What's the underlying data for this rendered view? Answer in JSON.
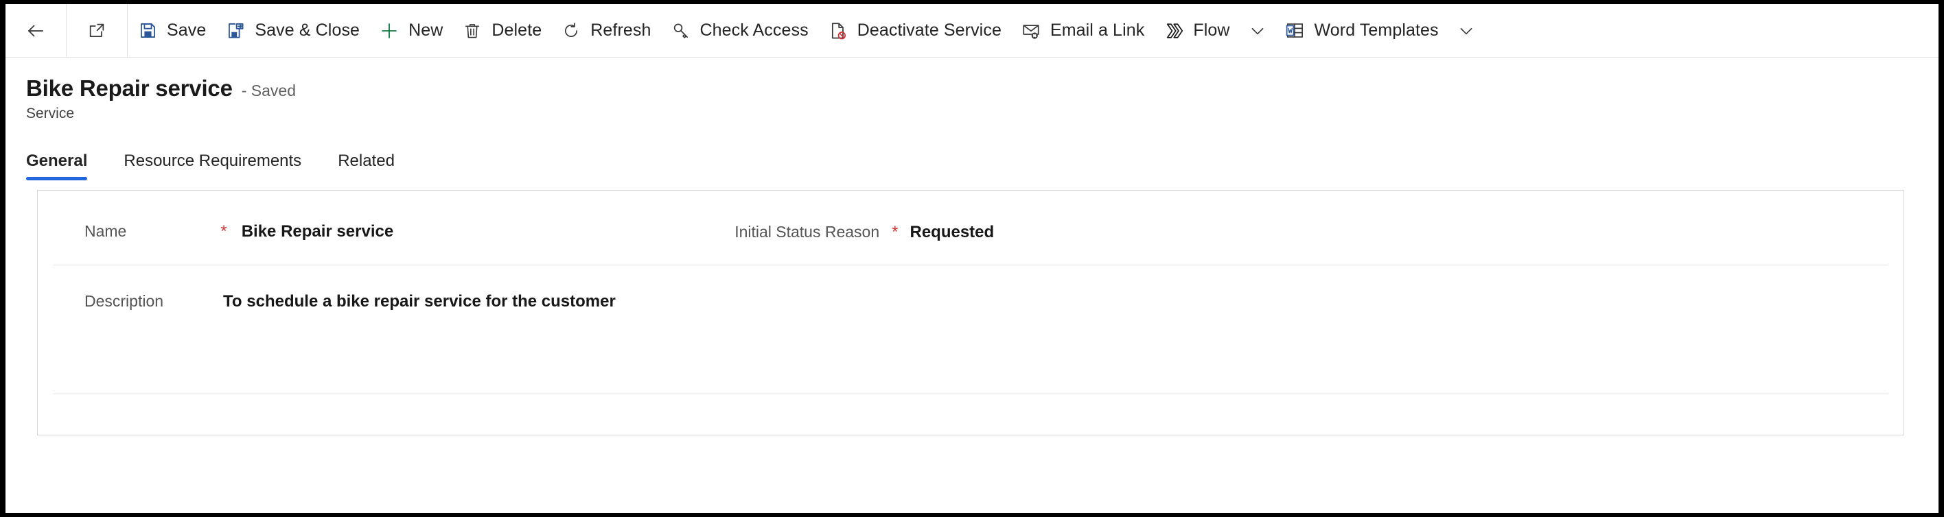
{
  "theme": {
    "accent": "#2266dd",
    "required_color": "#d13438",
    "border_color": "#d6d6d6",
    "label_color": "#545454"
  },
  "commandbar": {
    "back": {
      "icon": "back-arrow-icon",
      "label": "Back"
    },
    "popout": {
      "icon": "open-in-new-window-icon",
      "label": "Open in new window"
    },
    "buttons": [
      {
        "id": "save",
        "icon": "save-icon",
        "label": "Save"
      },
      {
        "id": "save-close",
        "icon": "save-and-close-icon",
        "label": "Save & Close"
      },
      {
        "id": "new",
        "icon": "plus-icon",
        "label": "New"
      },
      {
        "id": "delete",
        "icon": "trash-icon",
        "label": "Delete"
      },
      {
        "id": "refresh",
        "icon": "refresh-icon",
        "label": "Refresh"
      },
      {
        "id": "check-access",
        "icon": "key-icon",
        "label": "Check Access"
      },
      {
        "id": "deactivate",
        "icon": "deactivate-icon",
        "label": "Deactivate Service"
      },
      {
        "id": "email-link",
        "icon": "email-link-icon",
        "label": "Email a Link"
      },
      {
        "id": "flow",
        "icon": "flow-icon",
        "label": "Flow",
        "caret": true
      },
      {
        "id": "word-templates",
        "icon": "word-icon",
        "label": "Word Templates",
        "caret": true
      }
    ]
  },
  "header": {
    "title": "Bike Repair service",
    "save_state": "- Saved",
    "entity": "Service"
  },
  "tabs": [
    {
      "id": "general",
      "label": "General",
      "active": true
    },
    {
      "id": "resource-requirements",
      "label": "Resource Requirements",
      "active": false
    },
    {
      "id": "related",
      "label": "Related",
      "active": false
    }
  ],
  "form": {
    "fields": [
      {
        "id": "name",
        "label": "Name",
        "required": true,
        "value": "Bike Repair service"
      },
      {
        "id": "initial-status-reason",
        "label": "Initial Status Reason",
        "required": true,
        "value": "Requested"
      },
      {
        "id": "description",
        "label": "Description",
        "required": false,
        "value": "To schedule a bike repair service for the customer"
      }
    ]
  }
}
